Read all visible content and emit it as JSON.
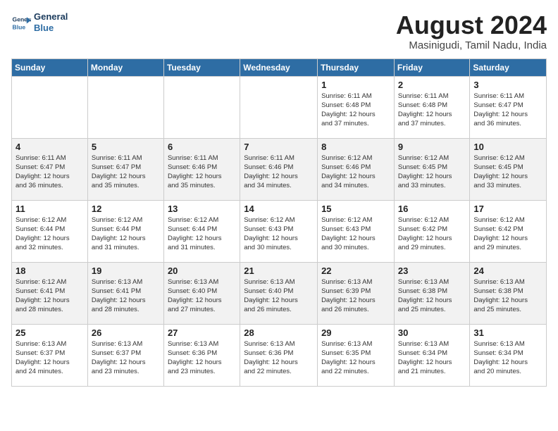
{
  "logo": {
    "line1": "General",
    "line2": "Blue"
  },
  "title": "August 2024",
  "location": "Masinigudi, Tamil Nadu, India",
  "days_of_week": [
    "Sunday",
    "Monday",
    "Tuesday",
    "Wednesday",
    "Thursday",
    "Friday",
    "Saturday"
  ],
  "weeks": [
    [
      {
        "day": "",
        "info": ""
      },
      {
        "day": "",
        "info": ""
      },
      {
        "day": "",
        "info": ""
      },
      {
        "day": "",
        "info": ""
      },
      {
        "day": "1",
        "info": "Sunrise: 6:11 AM\nSunset: 6:48 PM\nDaylight: 12 hours\nand 37 minutes."
      },
      {
        "day": "2",
        "info": "Sunrise: 6:11 AM\nSunset: 6:48 PM\nDaylight: 12 hours\nand 37 minutes."
      },
      {
        "day": "3",
        "info": "Sunrise: 6:11 AM\nSunset: 6:47 PM\nDaylight: 12 hours\nand 36 minutes."
      }
    ],
    [
      {
        "day": "4",
        "info": "Sunrise: 6:11 AM\nSunset: 6:47 PM\nDaylight: 12 hours\nand 36 minutes."
      },
      {
        "day": "5",
        "info": "Sunrise: 6:11 AM\nSunset: 6:47 PM\nDaylight: 12 hours\nand 35 minutes."
      },
      {
        "day": "6",
        "info": "Sunrise: 6:11 AM\nSunset: 6:46 PM\nDaylight: 12 hours\nand 35 minutes."
      },
      {
        "day": "7",
        "info": "Sunrise: 6:11 AM\nSunset: 6:46 PM\nDaylight: 12 hours\nand 34 minutes."
      },
      {
        "day": "8",
        "info": "Sunrise: 6:12 AM\nSunset: 6:46 PM\nDaylight: 12 hours\nand 34 minutes."
      },
      {
        "day": "9",
        "info": "Sunrise: 6:12 AM\nSunset: 6:45 PM\nDaylight: 12 hours\nand 33 minutes."
      },
      {
        "day": "10",
        "info": "Sunrise: 6:12 AM\nSunset: 6:45 PM\nDaylight: 12 hours\nand 33 minutes."
      }
    ],
    [
      {
        "day": "11",
        "info": "Sunrise: 6:12 AM\nSunset: 6:44 PM\nDaylight: 12 hours\nand 32 minutes."
      },
      {
        "day": "12",
        "info": "Sunrise: 6:12 AM\nSunset: 6:44 PM\nDaylight: 12 hours\nand 31 minutes."
      },
      {
        "day": "13",
        "info": "Sunrise: 6:12 AM\nSunset: 6:44 PM\nDaylight: 12 hours\nand 31 minutes."
      },
      {
        "day": "14",
        "info": "Sunrise: 6:12 AM\nSunset: 6:43 PM\nDaylight: 12 hours\nand 30 minutes."
      },
      {
        "day": "15",
        "info": "Sunrise: 6:12 AM\nSunset: 6:43 PM\nDaylight: 12 hours\nand 30 minutes."
      },
      {
        "day": "16",
        "info": "Sunrise: 6:12 AM\nSunset: 6:42 PM\nDaylight: 12 hours\nand 29 minutes."
      },
      {
        "day": "17",
        "info": "Sunrise: 6:12 AM\nSunset: 6:42 PM\nDaylight: 12 hours\nand 29 minutes."
      }
    ],
    [
      {
        "day": "18",
        "info": "Sunrise: 6:12 AM\nSunset: 6:41 PM\nDaylight: 12 hours\nand 28 minutes."
      },
      {
        "day": "19",
        "info": "Sunrise: 6:13 AM\nSunset: 6:41 PM\nDaylight: 12 hours\nand 28 minutes."
      },
      {
        "day": "20",
        "info": "Sunrise: 6:13 AM\nSunset: 6:40 PM\nDaylight: 12 hours\nand 27 minutes."
      },
      {
        "day": "21",
        "info": "Sunrise: 6:13 AM\nSunset: 6:40 PM\nDaylight: 12 hours\nand 26 minutes."
      },
      {
        "day": "22",
        "info": "Sunrise: 6:13 AM\nSunset: 6:39 PM\nDaylight: 12 hours\nand 26 minutes."
      },
      {
        "day": "23",
        "info": "Sunrise: 6:13 AM\nSunset: 6:38 PM\nDaylight: 12 hours\nand 25 minutes."
      },
      {
        "day": "24",
        "info": "Sunrise: 6:13 AM\nSunset: 6:38 PM\nDaylight: 12 hours\nand 25 minutes."
      }
    ],
    [
      {
        "day": "25",
        "info": "Sunrise: 6:13 AM\nSunset: 6:37 PM\nDaylight: 12 hours\nand 24 minutes."
      },
      {
        "day": "26",
        "info": "Sunrise: 6:13 AM\nSunset: 6:37 PM\nDaylight: 12 hours\nand 23 minutes."
      },
      {
        "day": "27",
        "info": "Sunrise: 6:13 AM\nSunset: 6:36 PM\nDaylight: 12 hours\nand 23 minutes."
      },
      {
        "day": "28",
        "info": "Sunrise: 6:13 AM\nSunset: 6:36 PM\nDaylight: 12 hours\nand 22 minutes."
      },
      {
        "day": "29",
        "info": "Sunrise: 6:13 AM\nSunset: 6:35 PM\nDaylight: 12 hours\nand 22 minutes."
      },
      {
        "day": "30",
        "info": "Sunrise: 6:13 AM\nSunset: 6:34 PM\nDaylight: 12 hours\nand 21 minutes."
      },
      {
        "day": "31",
        "info": "Sunrise: 6:13 AM\nSunset: 6:34 PM\nDaylight: 12 hours\nand 20 minutes."
      }
    ]
  ]
}
